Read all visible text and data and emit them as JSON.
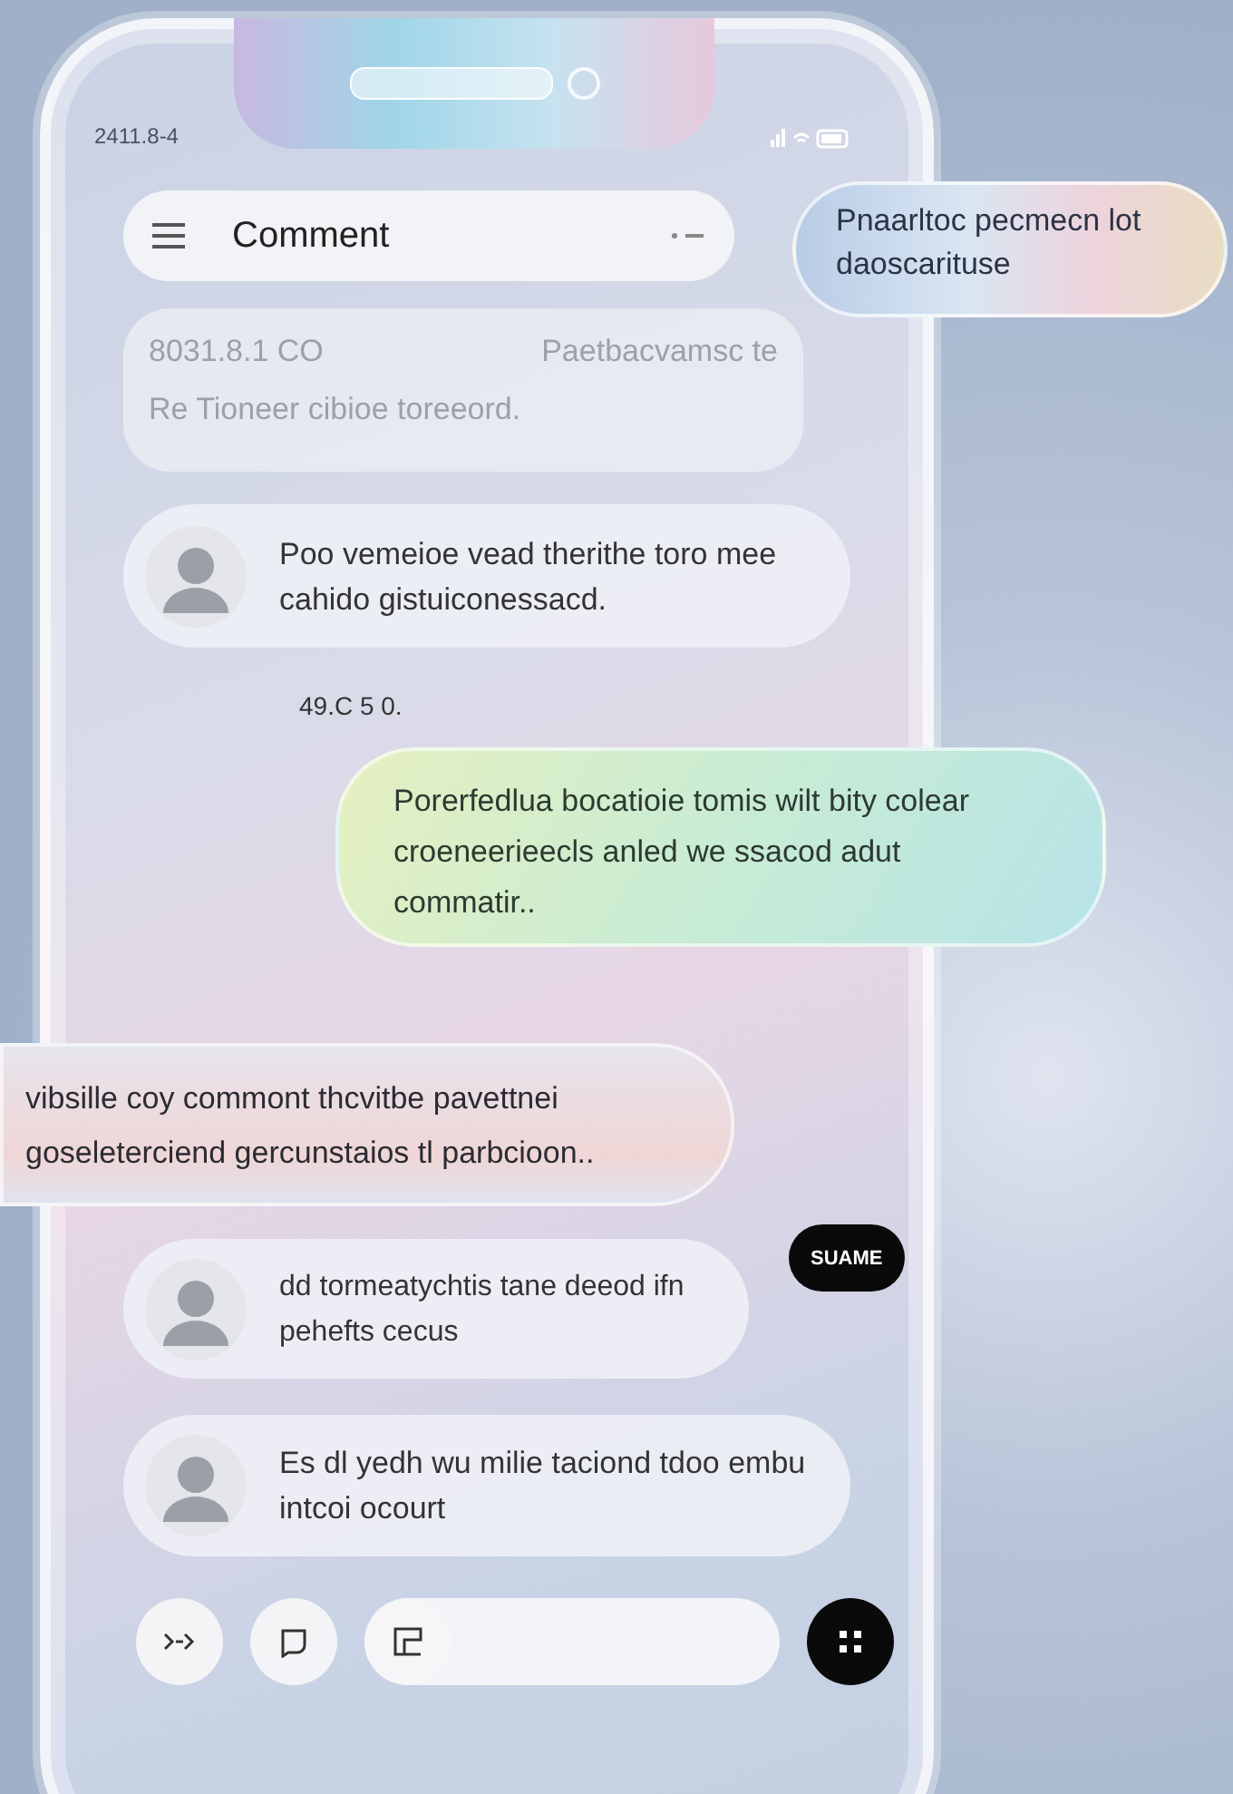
{
  "status_bar": {
    "time": "2411.8-4"
  },
  "header": {
    "title": "Comment"
  },
  "info_card": {
    "code": "8031.8.1 CO",
    "tag": "Paetbacvamsc te",
    "text": "Re Tioneer cibioe toreeord."
  },
  "floating_note": {
    "text": "Pnaarltoc pecmecn lot daoscarituse"
  },
  "messages": [
    {
      "kind": "comment",
      "text": "Poo vemeioe vead therithe toro mee cahido gistuiconessacd."
    },
    {
      "kind": "timestamp",
      "text": "49.C 5 0."
    },
    {
      "kind": "bubble",
      "text": "Porerfedlua bocatioie tomis wilt bity colear croeneerieecls anled we ssacod adut commatir.."
    },
    {
      "kind": "wide_bubble",
      "text": "vibsille coy commont thcvitbe pavettnei goseleterciend gercunstaios tl parbcioon.."
    },
    {
      "kind": "comment",
      "text": "dd tormeatychtis tane deeod ifn pehefts cecus",
      "button": "SUAME"
    },
    {
      "kind": "comment",
      "text": "Es dl yedh wu milie taciond tdoo embu intcoi ocourt"
    }
  ]
}
